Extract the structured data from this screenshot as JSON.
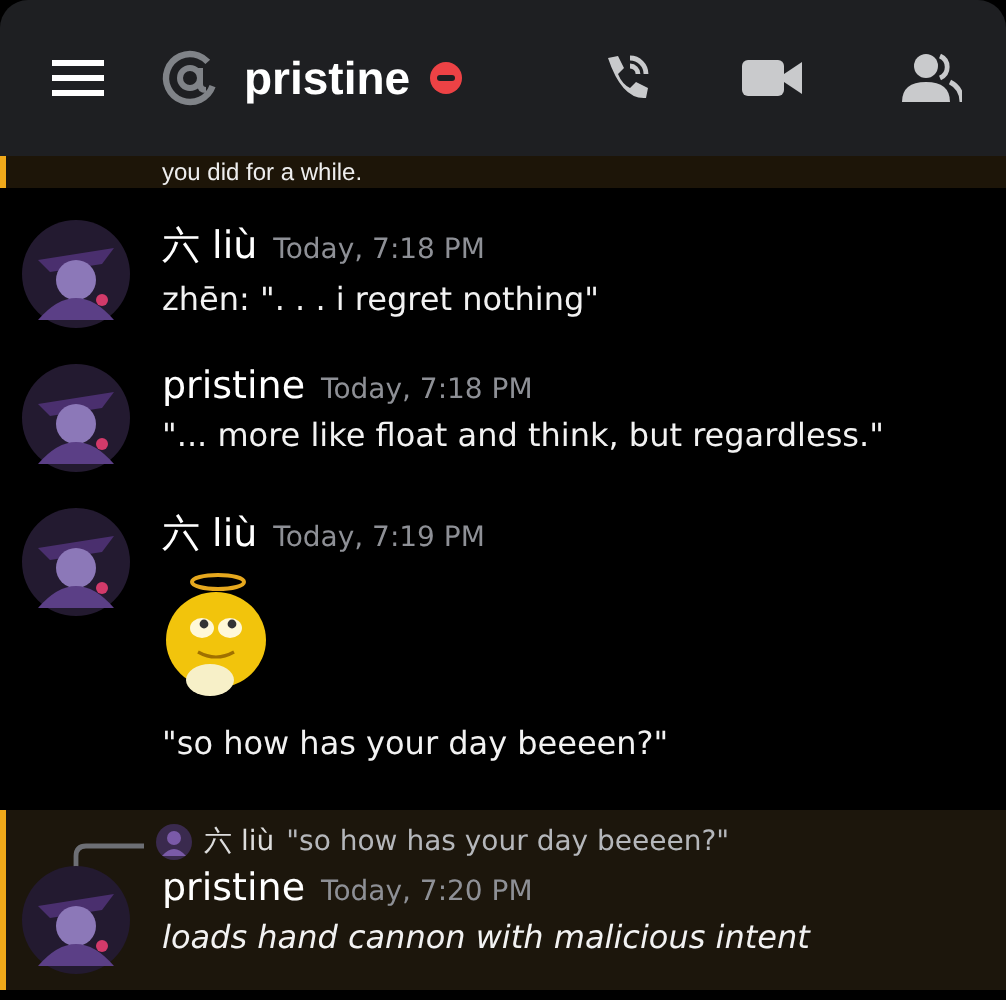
{
  "header": {
    "title": "pristine",
    "do_not_disturb": true
  },
  "banner": {
    "text": "you did for a while.",
    "highlighted": true
  },
  "messages": [
    {
      "author": "六 liù",
      "time": "Today, 7:18 PM",
      "highlighted": false,
      "content": [
        {
          "kind": "text",
          "text": "zhēn: \". . . i regret nothing\""
        }
      ]
    },
    {
      "author": "pristine",
      "time": "Today, 7:18 PM",
      "highlighted": false,
      "content": [
        {
          "kind": "text",
          "text": "\"... more like float and think, but regardless.\""
        }
      ]
    },
    {
      "author": "六 liù",
      "time": "Today, 7:19 PM",
      "highlighted": false,
      "content": [
        {
          "kind": "emoji"
        },
        {
          "kind": "text",
          "text": "\"so how has your day beeeen?\""
        }
      ]
    },
    {
      "author": "pristine",
      "time": "Today, 7:20 PM",
      "highlighted": true,
      "reply": {
        "author": "六 liù",
        "text": "\"so how has your day beeeen?\""
      },
      "content": [
        {
          "kind": "italic",
          "text": "loads hand cannon with malicious intent"
        }
      ]
    }
  ]
}
